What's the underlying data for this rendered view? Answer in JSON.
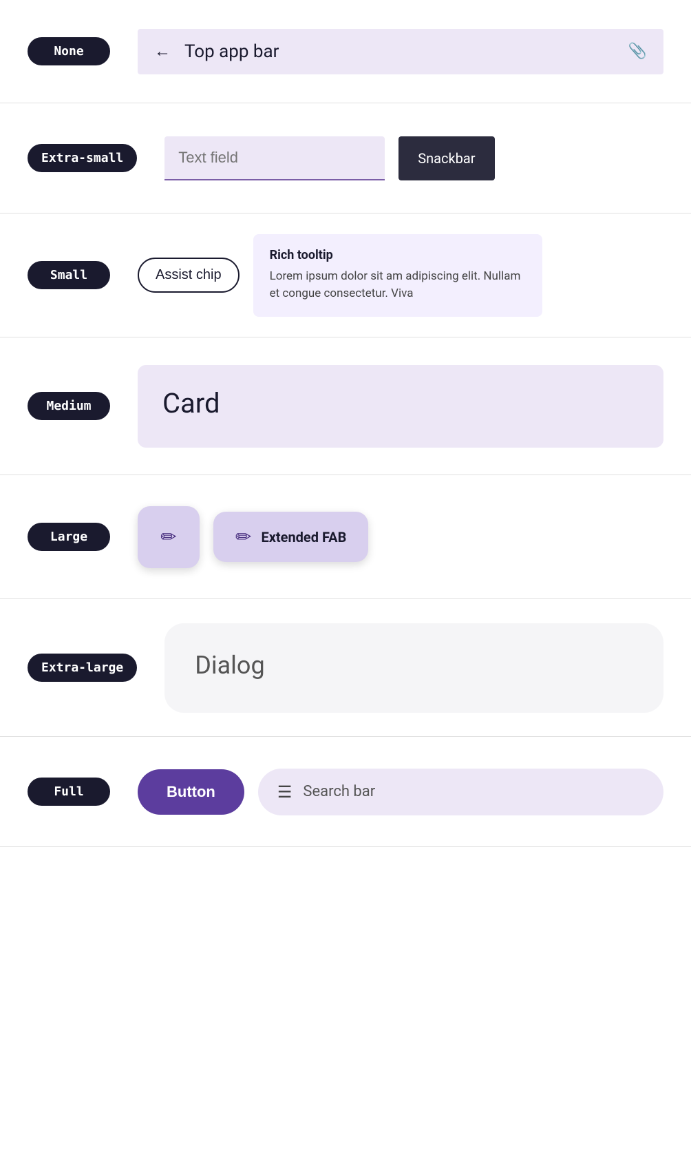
{
  "rows": [
    {
      "id": "none",
      "badge": "None",
      "components": {
        "top_app_bar": {
          "title": "Top app bar",
          "back_icon": "←",
          "attach_icon": "📎"
        }
      }
    },
    {
      "id": "extra-small",
      "badge": "Extra-small",
      "components": {
        "text_field": {
          "placeholder": "Text field"
        },
        "snackbar": {
          "label": "Snackbar"
        }
      }
    },
    {
      "id": "small",
      "badge": "Small",
      "components": {
        "assist_chip": {
          "label": "Assist chip"
        },
        "rich_tooltip": {
          "title": "Rich tooltip",
          "body": "Lorem ipsum dolor sit am adipiscing elit. Nullam et congue consectetur. Viva"
        }
      }
    },
    {
      "id": "medium",
      "badge": "Medium",
      "components": {
        "card": {
          "title": "Card"
        }
      }
    },
    {
      "id": "large",
      "badge": "Large",
      "components": {
        "fab": {
          "icon": "✏"
        },
        "extended_fab": {
          "icon": "✏",
          "label": "Extended FAB"
        }
      }
    },
    {
      "id": "extra-large",
      "badge": "Extra-large",
      "components": {
        "dialog": {
          "title": "Dialog"
        }
      }
    },
    {
      "id": "full",
      "badge": "Full",
      "components": {
        "button": {
          "label": "Button"
        },
        "search_bar": {
          "icon": "☰",
          "placeholder": "Search bar"
        }
      }
    }
  ]
}
